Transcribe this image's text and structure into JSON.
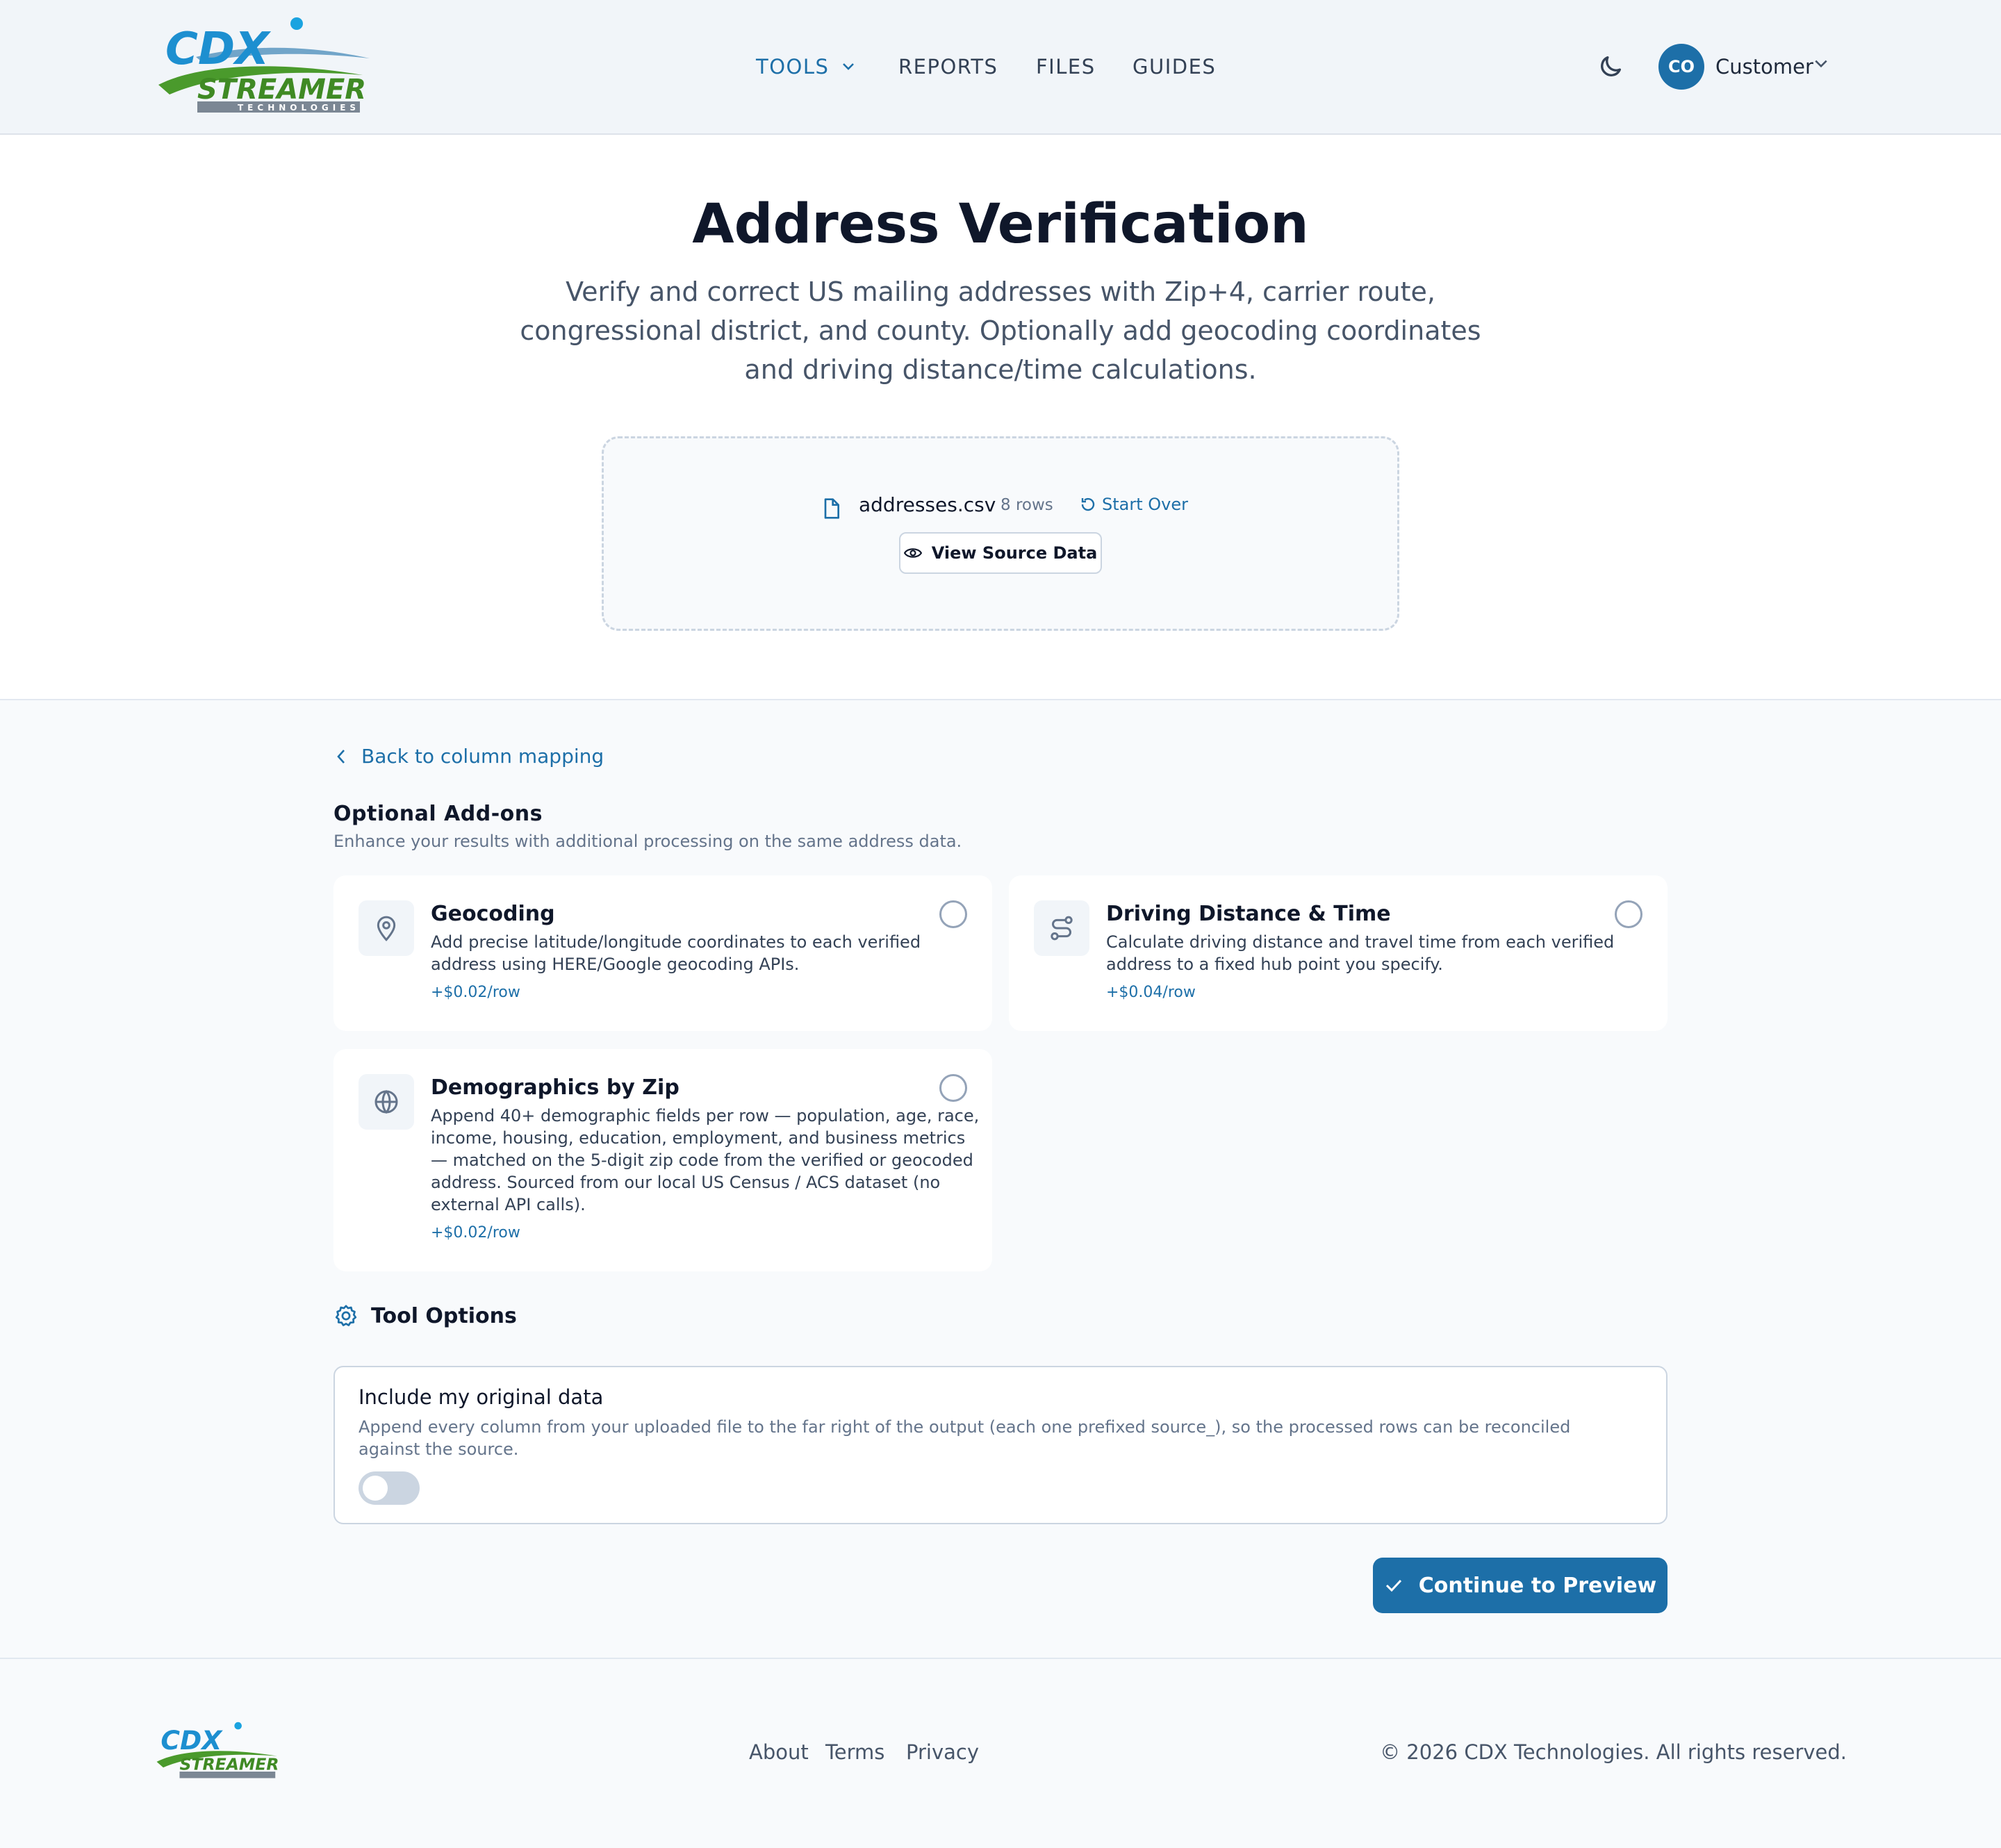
{
  "brand": {
    "logo_top": "CDX",
    "logo_middle": "STREAMER",
    "logo_bottom": "TECHNOLOGIES",
    "primary_color": "#1d6fa8",
    "green_color": "#4a9a2c"
  },
  "nav": {
    "tools": "TOOLS",
    "reports": "REPORTS",
    "files": "FILES",
    "guides": "GUIDES"
  },
  "user": {
    "initials": "CO",
    "name": "Customer"
  },
  "hero": {
    "title": "Address Verification",
    "subtitle": "Verify and correct US mailing addresses with Zip+4, carrier route, congressional district, and county. Optionally add geocoding coordinates and driving distance/time calculations."
  },
  "upload": {
    "file_name": "addresses.csv",
    "row_count": "8 rows",
    "start_over": "Start Over",
    "view_source": "View Source Data"
  },
  "main": {
    "back_link": "Back to column mapping",
    "addons_title": "Optional Add-ons",
    "addons_subtitle": "Enhance your results with additional processing on the same address data.",
    "addons": [
      {
        "title": "Geocoding",
        "description": "Add precise latitude/longitude coordinates to each verified address using HERE/Google geocoding APIs.",
        "price": "+$0.02/row",
        "icon": "map-pin-icon",
        "selected": false
      },
      {
        "title": "Driving Distance & Time",
        "description": "Calculate driving distance and travel time from each verified address to a fixed hub point you specify.",
        "price": "+$0.04/row",
        "icon": "route-icon",
        "selected": false
      },
      {
        "title": "Demographics by Zip",
        "description": "Append 40+ demographic fields per row — population, age, race, income, housing, education, employment, and business metrics — matched on the 5-digit zip code from the verified or geocoded address. Sourced from our local US Census / ACS dataset (no external API calls).",
        "price": "+$0.02/row",
        "icon": "globe-icon",
        "selected": false
      }
    ],
    "tool_options_title": "Tool Options",
    "include_original": {
      "title": "Include my original data",
      "description": "Append every column from your uploaded file to the far right of the output (each one prefixed source_), so the processed rows can be reconciled against the source.",
      "enabled": false
    },
    "continue": "Continue to Preview"
  },
  "footer": {
    "about": "About",
    "terms": "Terms",
    "privacy": "Privacy",
    "copyright": "© 2026 CDX Technologies. All rights reserved."
  }
}
